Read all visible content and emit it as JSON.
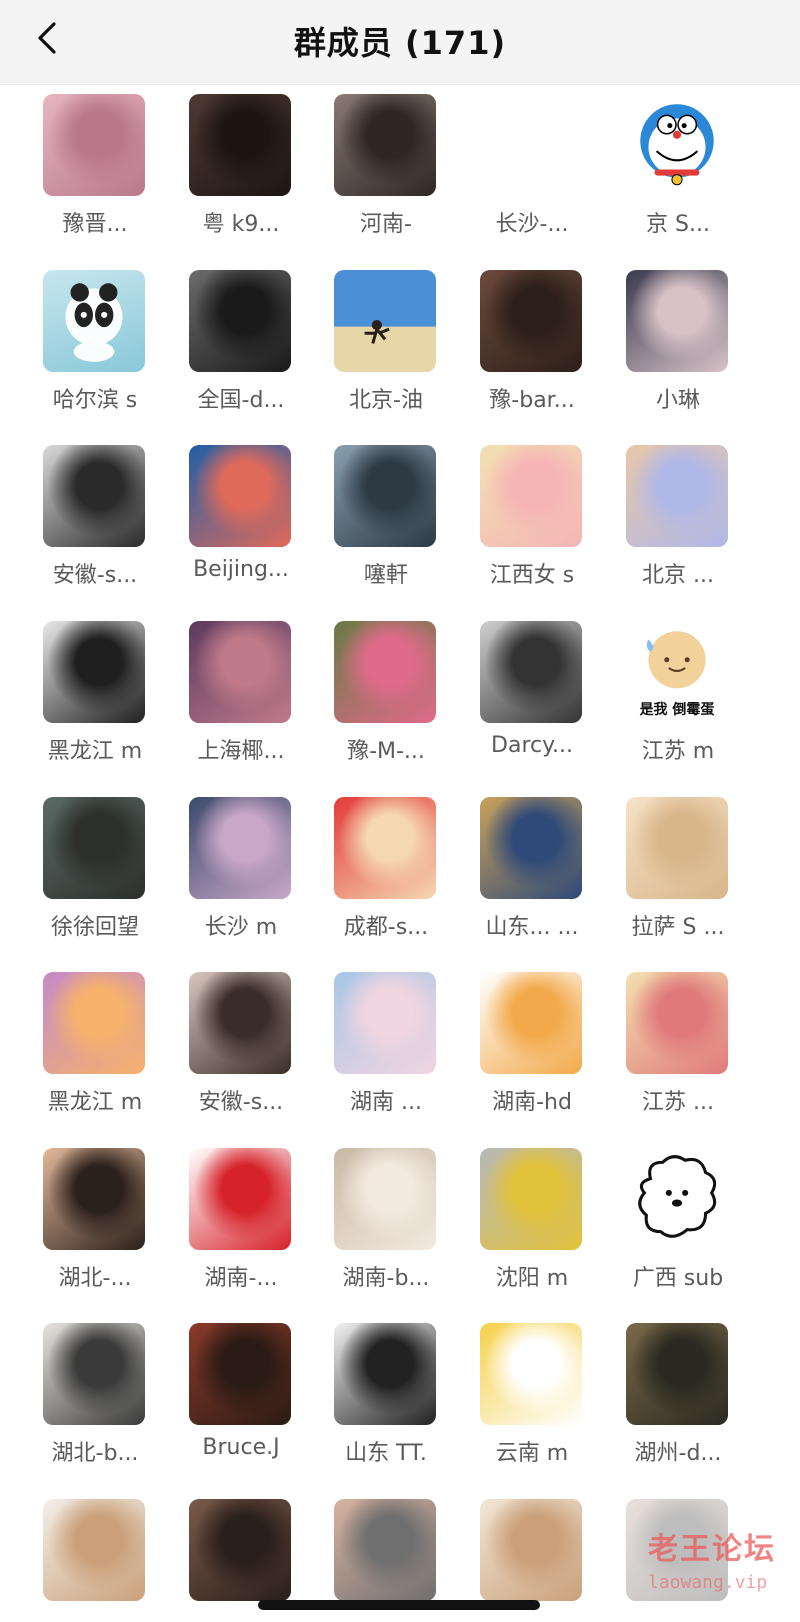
{
  "header": {
    "title": "群成员 (171)",
    "back_icon": "chevron-left-icon"
  },
  "members": [
    {
      "name": "豫晋...",
      "avatar": {
        "type": "photo",
        "colors": [
          "#e7b7c0",
          "#b9788a"
        ]
      }
    },
    {
      "name": "粤 k9...",
      "avatar": {
        "type": "photo",
        "colors": [
          "#4e3a33",
          "#1e1513"
        ]
      }
    },
    {
      "name": "河南-",
      "avatar": {
        "type": "photo",
        "colors": [
          "#8a7a74",
          "#2f2724"
        ]
      }
    },
    {
      "name": "长沙-...",
      "avatar": {
        "type": "blank",
        "colors": [
          "#ffffff",
          "#ffffff"
        ]
      }
    },
    {
      "name": "京 S...",
      "avatar": {
        "type": "doraemon",
        "colors": [
          "#2b88d8",
          "#ffffff"
        ]
      }
    },
    {
      "name": "哈尔滨 s",
      "avatar": {
        "type": "panda",
        "colors": [
          "#c7e6ef",
          "#88c8d8"
        ]
      }
    },
    {
      "name": "全国-d...",
      "avatar": {
        "type": "photo",
        "colors": [
          "#6b6b6b",
          "#1a1a1a"
        ]
      }
    },
    {
      "name": "北京-油",
      "avatar": {
        "type": "beach",
        "colors": [
          "#4b8fd6",
          "#e6d6a8"
        ]
      }
    },
    {
      "name": "豫-bar...",
      "avatar": {
        "type": "photo",
        "colors": [
          "#6c4a3c",
          "#2d1f19"
        ]
      }
    },
    {
      "name": "小琳",
      "avatar": {
        "type": "photo",
        "colors": [
          "#3a3a4e",
          "#d7c2c7"
        ]
      }
    },
    {
      "name": "安徽-s...",
      "avatar": {
        "type": "photo",
        "colors": [
          "#d9d9d9",
          "#2a2a2a"
        ]
      }
    },
    {
      "name": "Beijing...",
      "avatar": {
        "type": "photo",
        "colors": [
          "#1f5ea8",
          "#e06a5a"
        ]
      }
    },
    {
      "name": "噻軒",
      "avatar": {
        "type": "photo",
        "colors": [
          "#8aa0b1",
          "#2d3a44"
        ]
      }
    },
    {
      "name": "江西女 s",
      "avatar": {
        "type": "photo",
        "colors": [
          "#f3e1b3",
          "#f5b5b5"
        ]
      }
    },
    {
      "name": "北京 ...",
      "avatar": {
        "type": "photo",
        "colors": [
          "#e8c7a8",
          "#b0b8e8"
        ]
      }
    },
    {
      "name": "黑龙江 m",
      "avatar": {
        "type": "photo",
        "colors": [
          "#e8e8e8",
          "#1f1f1f"
        ]
      }
    },
    {
      "name": "上海椰...",
      "avatar": {
        "type": "photo",
        "colors": [
          "#5b3a5e",
          "#c07a8a"
        ]
      }
    },
    {
      "name": "豫-M-...",
      "avatar": {
        "type": "photo",
        "colors": [
          "#6b7a45",
          "#e06a8a"
        ]
      }
    },
    {
      "name": "Darcy...",
      "avatar": {
        "type": "photo",
        "colors": [
          "#cfcfcf",
          "#333333"
        ]
      }
    },
    {
      "name": "江苏 m",
      "avatar": {
        "type": "sticker",
        "colors": [
          "#ffffff",
          "#f3d19a"
        ],
        "caption": "是我 倒霉蛋"
      }
    },
    {
      "name": "徐徐回望",
      "avatar": {
        "type": "photo",
        "colors": [
          "#5b6b66",
          "#2c2f2c"
        ]
      }
    },
    {
      "name": "长沙 m",
      "avatar": {
        "type": "photo",
        "colors": [
          "#3b4a6a",
          "#c9a7c9"
        ]
      }
    },
    {
      "name": "成都-s...",
      "avatar": {
        "type": "photo",
        "colors": [
          "#e33a3a",
          "#f5d7b0"
        ]
      }
    },
    {
      "name": "山东... ...",
      "avatar": {
        "type": "photo",
        "colors": [
          "#caa25a",
          "#2f4a78"
        ]
      }
    },
    {
      "name": "拉萨 S ...",
      "avatar": {
        "type": "photo",
        "colors": [
          "#f5e3c6",
          "#d9b58a"
        ]
      }
    },
    {
      "name": "黑龙江 m",
      "avatar": {
        "type": "photo",
        "colors": [
          "#c58ac9",
          "#f6b26b"
        ]
      }
    },
    {
      "name": "安徽-s...",
      "avatar": {
        "type": "photo",
        "colors": [
          "#d8c6be",
          "#3a2c28"
        ]
      }
    },
    {
      "name": "湖南 ...",
      "avatar": {
        "type": "photo",
        "colors": [
          "#a8c6e8",
          "#f1d5e0"
        ]
      }
    },
    {
      "name": "湖南-hd",
      "avatar": {
        "type": "photo",
        "colors": [
          "#ffffff",
          "#f2a94a"
        ]
      }
    },
    {
      "name": "江苏 ...",
      "avatar": {
        "type": "photo",
        "colors": [
          "#f3e0b0",
          "#e07a7a"
        ]
      }
    },
    {
      "name": "湖北-...",
      "avatar": {
        "type": "photo",
        "colors": [
          "#e1b89a",
          "#2c201b"
        ]
      }
    },
    {
      "name": "湖南-...",
      "avatar": {
        "type": "photo",
        "colors": [
          "#ffffff",
          "#d6222a"
        ]
      }
    },
    {
      "name": "湖南-b...",
      "avatar": {
        "type": "photo",
        "colors": [
          "#c9b9a4",
          "#f3e9df"
        ]
      }
    },
    {
      "name": "沈阳 m",
      "avatar": {
        "type": "photo",
        "colors": [
          "#b8b8b8",
          "#e2c23a"
        ]
      }
    },
    {
      "name": "广西 sub",
      "avatar": {
        "type": "sticker-dog",
        "colors": [
          "#ffffff",
          "#111111"
        ]
      }
    },
    {
      "name": "湖北-b...",
      "avatar": {
        "type": "photo",
        "colors": [
          "#e7e4df",
          "#3a3a3a"
        ]
      }
    },
    {
      "name": "Bruce.J",
      "avatar": {
        "type": "photo",
        "colors": [
          "#8a3a2a",
          "#2a1b14"
        ]
      }
    },
    {
      "name": "山东 TT.",
      "avatar": {
        "type": "photo",
        "colors": [
          "#f1f1f1",
          "#222222"
        ]
      }
    },
    {
      "name": "云南 m",
      "avatar": {
        "type": "photo",
        "colors": [
          "#f5d04a",
          "#ffffff"
        ]
      }
    },
    {
      "name": "湖州-d...",
      "avatar": {
        "type": "photo",
        "colors": [
          "#7a6a4a",
          "#2a2a20"
        ]
      }
    },
    {
      "name": "",
      "avatar": {
        "type": "photo",
        "colors": [
          "#f3efe8",
          "#caa07a"
        ]
      }
    },
    {
      "name": "",
      "avatar": {
        "type": "photo",
        "colors": [
          "#7a5a4a",
          "#2a1f1a"
        ]
      }
    },
    {
      "name": "",
      "avatar": {
        "type": "photo",
        "colors": [
          "#d8b2a0",
          "#6f6f6f"
        ]
      }
    },
    {
      "name": "",
      "avatar": {
        "type": "photo",
        "colors": [
          "#f2e6d6",
          "#caa07a"
        ]
      }
    },
    {
      "name": "",
      "avatar": {
        "type": "photo",
        "colors": [
          "#e9e0dc",
          "#bdbdbd"
        ]
      }
    }
  ],
  "watermark": {
    "main": "老王论坛",
    "sub": "laowang.vip"
  }
}
